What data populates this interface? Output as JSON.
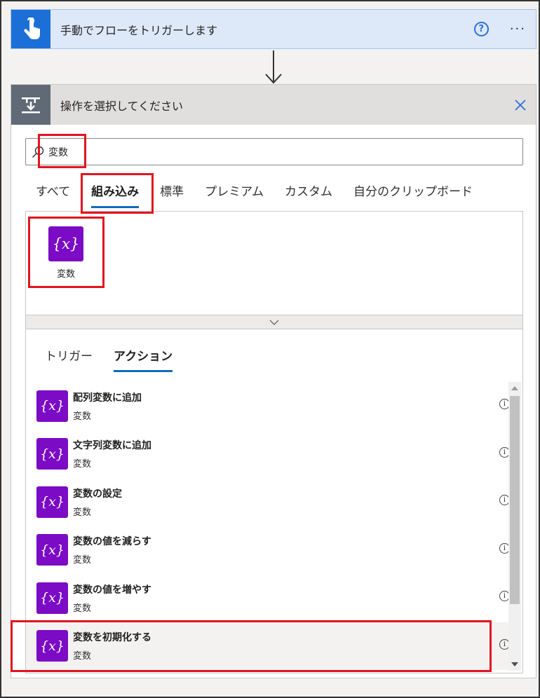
{
  "trigger": {
    "title": "手動でフローをトリガーします",
    "help_icon": "question-circle-icon",
    "more_icon": "more-ellipsis-icon",
    "icon": "hand-touch-icon",
    "color": "#1b6fd6"
  },
  "action_panel": {
    "title": "操作を選択してください",
    "icon": "operation-icon",
    "close_icon": "close-icon",
    "search": {
      "value": "変数",
      "icon": "search-icon"
    },
    "tabs": [
      {
        "label": "すべて",
        "active": false
      },
      {
        "label": "組み込み",
        "active": true
      },
      {
        "label": "標準",
        "active": false
      },
      {
        "label": "プレミアム",
        "active": false
      },
      {
        "label": "カスタム",
        "active": false
      },
      {
        "label": "自分のクリップボード",
        "active": false
      }
    ],
    "connector": {
      "label": "変数",
      "icon_text": "{x}",
      "color": "#7b0bc5"
    },
    "subtabs": [
      {
        "label": "トリガー",
        "active": false
      },
      {
        "label": "アクション",
        "active": true
      }
    ],
    "actions": [
      {
        "title": "配列変数に追加",
        "subtitle": "変数",
        "icon_text": "{x}"
      },
      {
        "title": "文字列変数に追加",
        "subtitle": "変数",
        "icon_text": "{x}"
      },
      {
        "title": "変数の設定",
        "subtitle": "変数",
        "icon_text": "{x}"
      },
      {
        "title": "変数の値を減らす",
        "subtitle": "変数",
        "icon_text": "{x}"
      },
      {
        "title": "変数の値を増やす",
        "subtitle": "変数",
        "icon_text": "{x}"
      },
      {
        "title": "変数を初期化する",
        "subtitle": "変数",
        "icon_text": "{x}"
      }
    ],
    "info_icon_text": "i"
  },
  "highlight_color": "#e0151f"
}
